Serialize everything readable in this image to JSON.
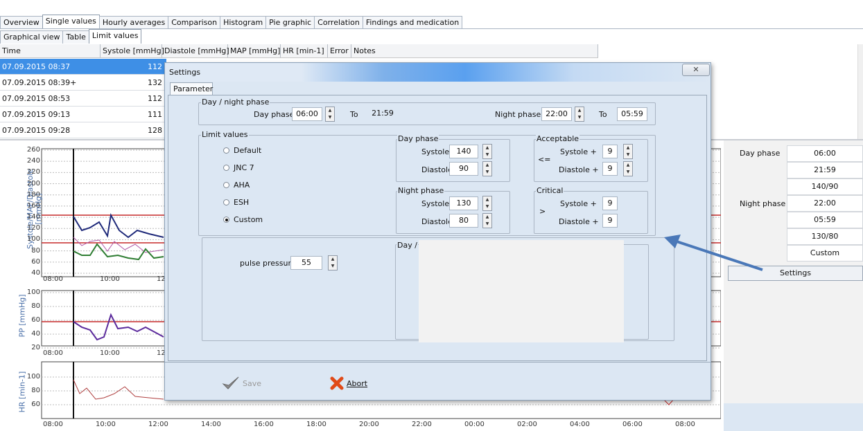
{
  "tabs_top": [
    "Overview",
    "Single values",
    "Hourly averages",
    "Comparison",
    "Histogram",
    "Pie graphic",
    "Correlation",
    "Findings and medication"
  ],
  "tabs_sub": [
    "Graphical view",
    "Table",
    "Limit values"
  ],
  "grid": {
    "headers": [
      "Time",
      "Systole [mmHg]",
      "Diastole [mmHg]",
      "MAP [mmHg]",
      "HR [min-1]",
      "Error",
      "Notes"
    ],
    "rows": [
      {
        "time": "07.09.2015  08:37",
        "systole": "112"
      },
      {
        "time": "07.09.2015  08:39+",
        "systole": "132"
      },
      {
        "time": "07.09.2015  08:53",
        "systole": "112"
      },
      {
        "time": "07.09.2015  09:13",
        "systole": "111"
      },
      {
        "time": "07.09.2015  09:28",
        "systole": "128"
      }
    ]
  },
  "charts": {
    "bp_ylabel": "Systole/MAP/Diastole [mmHg]",
    "bp_ticks": [
      "260",
      "240",
      "220",
      "200",
      "180",
      "160",
      "140",
      "120",
      "100",
      "80",
      "60",
      "40"
    ],
    "bp_xticks": [
      "08:00",
      "10:00",
      "12:"
    ],
    "pp_ylabel": "PP [mmHg]",
    "pp_ticks": [
      "100",
      "80",
      "60",
      "40",
      "20"
    ],
    "pp_xticks": [
      "08:00",
      "10:00",
      "12:"
    ],
    "hr_ylabel": "HR [min-1]",
    "hr_ticks": [
      "100",
      "80",
      "60"
    ],
    "hr_xticks": [
      "08:00",
      "10:00",
      "12:00",
      "14:00",
      "16:00",
      "18:00",
      "20:00",
      "22:00",
      "00:00",
      "02:00",
      "04:00",
      "06:00",
      "08:00"
    ]
  },
  "dialog": {
    "title": "Settings",
    "tab": "Parameter",
    "daynight": {
      "group_label": "Day / night phase",
      "day_label": "Day phase",
      "day_from": "06:00",
      "to1": "To",
      "day_to": "21:59",
      "night_label": "Night phase",
      "night_from": "22:00",
      "to2": "To",
      "night_to": "05:59"
    },
    "limits": {
      "group_label": "Limit values",
      "options": [
        "Default",
        "JNC 7",
        "AHA",
        "ESH",
        "Custom"
      ],
      "selected": "Custom"
    },
    "dayphase": {
      "group_label": "Day phase",
      "systole_label": "Systole",
      "systole": "140",
      "diastole_label": "Diastole",
      "diastole": "90"
    },
    "nightphase": {
      "group_label": "Night phase",
      "systole_label": "Systole",
      "systole": "130",
      "diastole_label": "Diastole",
      "diastole": "80"
    },
    "acceptable": {
      "group_label": "Acceptable",
      "op": "<=",
      "systole_label": "Systole  +",
      "systole": "9",
      "diastole_label": "Diastole  +",
      "diastole": "9"
    },
    "critical": {
      "group_label": "Critical",
      "op": ">",
      "systole_label": "Systole  +",
      "systole": "9",
      "diastole_label": "Diastole  +",
      "diastole": "9"
    },
    "pulse_label": "pulse pressure",
    "pulse_value": "55",
    "day_box_label": "Day /",
    "save_label": "Save",
    "abort_label": "Abort"
  },
  "right_panel": {
    "day_label": "Day phase",
    "day_values": [
      "06:00",
      "21:59",
      "140/90"
    ],
    "night_label": "Night phase",
    "night_values": [
      "22:00",
      "05:59",
      "130/80"
    ],
    "mode": "Custom",
    "settings_button": "Settings"
  },
  "colors": {
    "selection": "#3e8fe6",
    "dialog_bg": "#dce7f3",
    "arrow": "#4a78b8",
    "limit_line": "#c62828",
    "systole_line": "#1f2a7a",
    "diastole_line": "#2e7d32",
    "map_line": "#b05aa8"
  }
}
